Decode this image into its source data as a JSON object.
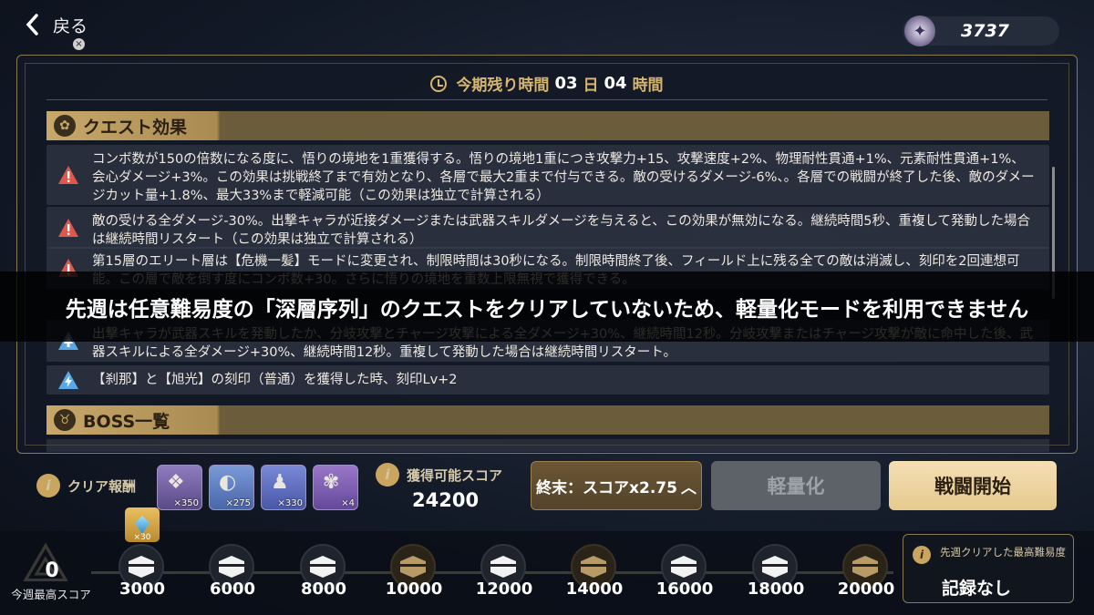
{
  "header": {
    "back_label": "戻る",
    "close_glyph": "×",
    "currency_value": "3737"
  },
  "timer": {
    "prefix": "今期残り時間",
    "days": "03",
    "days_unit": "日",
    "hours": "04",
    "hours_unit": "時間"
  },
  "quest_effects": {
    "title": "クエスト効果",
    "items": [
      {
        "icon": "warning-icon",
        "text": "コンボ数が150の倍数になる度に、悟りの境地を1重獲得する。悟りの境地1重につき攻撃力+15、攻撃速度+2%、物理耐性貫通+1%、元素耐性貫通+1%、会心ダメージ+3%。この効果は挑戦終了まで有効となり、各層で最大2重まで付与できる。敵の受けるダメージ-6%、。各層での戦闘が終了した後、敵のダメージカット量+1.8%、最大33%まで軽減可能（この効果は独立で計算される）"
      },
      {
        "icon": "warning-icon",
        "text": "敵の受ける全ダメージ-30%。出撃キャラが近接ダメージまたは武器スキルダメージを与えると、この効果が無効になる。継続時間5秒、重複して発動した場合は継続時間リスタート（この効果は独立で計算される）"
      },
      {
        "icon": "warning-icon",
        "text": "第15層のエリート層は【危機一髪】モードに変更され、制限時間は30秒になる。制限時間終了後、フィールド上に残る全ての敵は消滅し、刻印を2回連想可能。この層で敵を倒す度にコンボ数+30。さらに悟りの境地を重数上限無視で獲得できる。"
      },
      {
        "icon": "buff-icon",
        "text": "出撃キャラが武器スキルを発動したか、分岐攻撃とチャージ攻撃による全ダメージ+30%、継続時間12秒。分岐攻撃またはチャージ攻撃が敵に命中した後、武器スキルによる全ダメージ+30%、継続時間12秒。重複して発動した場合は継続時間リスタート。"
      },
      {
        "icon": "bolt-icon",
        "text": "【刹那】と【旭光】の刻印（普通）を獲得した時、刻印Lv+2"
      }
    ]
  },
  "boss_section": {
    "title": "BOSS一覧"
  },
  "banner": {
    "text": "先週は任意難易度の「深層序列」のクエストをクリアしていないため、軽量化モードを利用できません"
  },
  "rewards": {
    "label": "クリア報酬",
    "items": [
      {
        "name": "sigil-item",
        "qty": "×350",
        "color": "#7e6aa8"
      },
      {
        "name": "green-disc-item",
        "qty": "×275",
        "color": "#5f7fbf"
      },
      {
        "name": "penguin-item",
        "qty": "×330",
        "color": "#5f6fc0"
      },
      {
        "name": "flower-item",
        "qty": "×4",
        "color": "#7e5aa8"
      }
    ]
  },
  "score": {
    "label": "獲得可能スコア",
    "value": "24200"
  },
  "buttons": {
    "mode": "終末：スコアx2.75",
    "mode_chevron": "︿",
    "light": "軽量化",
    "start": "戦闘開始"
  },
  "progress": {
    "week_best_value": "0",
    "week_best_label": "今週最高スコア",
    "crystal_qty": "×30",
    "milestones": [
      {
        "score": "3000",
        "type": "white"
      },
      {
        "score": "6000",
        "type": "white"
      },
      {
        "score": "8000",
        "type": "white"
      },
      {
        "score": "10000",
        "type": "gold"
      },
      {
        "score": "12000",
        "type": "white"
      },
      {
        "score": "14000",
        "type": "gold"
      },
      {
        "score": "16000",
        "type": "white"
      },
      {
        "score": "18000",
        "type": "white"
      },
      {
        "score": "20000",
        "type": "gold"
      }
    ]
  },
  "best_difficulty": {
    "title": "先週クリアした最高難易度",
    "value": "記録なし"
  },
  "colors": {
    "accent_gold": "#c8a86a",
    "warning_red": "#e0574b",
    "buff_blue": "#5aa9e6",
    "start_button": "#f0d8a8"
  }
}
